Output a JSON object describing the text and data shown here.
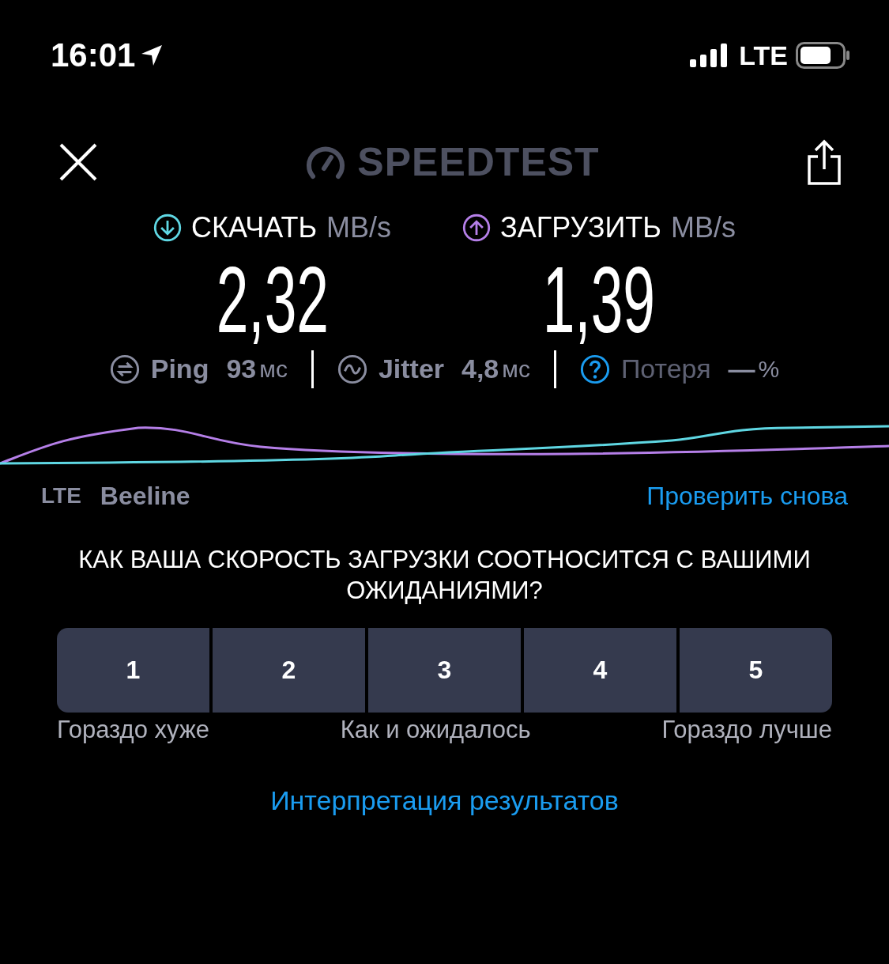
{
  "status_bar": {
    "time": "16:01",
    "network": "LTE"
  },
  "header": {
    "logo": "SPEEDTEST"
  },
  "speeds": [
    {
      "kind": "download",
      "label": "СКАЧАТЬ",
      "unit": "MB/s",
      "value": "2,32"
    },
    {
      "kind": "upload",
      "label": "ЗАГРУЗИТЬ",
      "unit": "MB/s",
      "value": "1,39"
    }
  ],
  "metrics": [
    {
      "kind": "ping",
      "label": "Ping",
      "value": "93",
      "unit": "мс"
    },
    {
      "kind": "jitter",
      "label": "Jitter",
      "value": "4,8",
      "unit": "мс"
    },
    {
      "kind": "loss",
      "label": "Потеря",
      "value": "—",
      "unit": "%"
    }
  ],
  "connection": {
    "type": "LTE",
    "provider": "Beeline"
  },
  "retest_link": "Проверить снова",
  "survey": {
    "question": "КАК ВАША СКОРОСТЬ ЗАГРУЗКИ СООТНОСИТСЯ С ВАШИМИ ОЖИДАНИЯМИ?",
    "options": [
      {
        "label": "1",
        "selected": false
      },
      {
        "label": "2",
        "selected": false
      },
      {
        "label": "3",
        "selected": false
      },
      {
        "label": "4",
        "selected": false
      },
      {
        "label": "5",
        "selected": false
      }
    ],
    "scale_labels": [
      "Гораздо хуже",
      "Как и ожидалось",
      "Гораздо лучше"
    ]
  },
  "results_link": "Интерпретация результатов"
}
